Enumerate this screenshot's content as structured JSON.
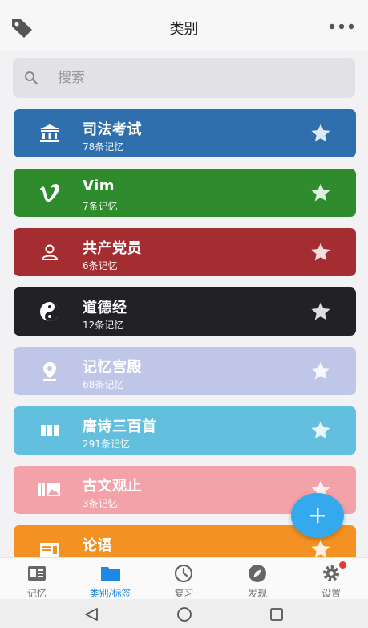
{
  "header": {
    "title": "类别",
    "left_icon": "tag-icon",
    "right_icon": "more-icon"
  },
  "search": {
    "placeholder": "搜索",
    "icon": "search-icon"
  },
  "categories": [
    {
      "name": "司法考试",
      "count": "78条记忆",
      "color": "#2f6fae",
      "icon": "bank-icon",
      "starred": true
    },
    {
      "name": "Vim",
      "count": "7条记忆",
      "color": "#2e8c2c",
      "icon": "vimeo-icon",
      "starred": true
    },
    {
      "name": "共产党员",
      "count": "6条记忆",
      "color": "#a42d31",
      "icon": "person-icon",
      "starred": true
    },
    {
      "name": "道德经",
      "count": "12条记忆",
      "color": "#222226",
      "icon": "yin-yang-icon",
      "starred": true
    },
    {
      "name": "记忆宫殿",
      "count": "68条记忆",
      "color": "#bfc6e8",
      "icon": "map-pin-icon",
      "starred": true
    },
    {
      "name": "唐诗三百首",
      "count": "291条记忆",
      "color": "#62bfdd",
      "icon": "columns-icon",
      "starred": true
    },
    {
      "name": "古文观止",
      "count": "3条记忆",
      "color": "#f3a2a9",
      "icon": "gallery-icon",
      "starred": true
    },
    {
      "name": "论语",
      "count": "",
      "color": "#f39223",
      "icon": "book-icon",
      "starred": true
    }
  ],
  "fab": {
    "icon": "plus-icon",
    "color": "#35a9ee"
  },
  "tabs": [
    {
      "label": "记忆",
      "icon": "memory-card-icon",
      "active": false
    },
    {
      "label": "类别/标签",
      "icon": "folder-icon",
      "active": true
    },
    {
      "label": "复习",
      "icon": "clock-icon",
      "active": false
    },
    {
      "label": "发现",
      "icon": "compass-icon",
      "active": false
    },
    {
      "label": "设置",
      "icon": "gear-icon",
      "active": false,
      "badge": true
    }
  ],
  "navbar": {
    "back_icon": "back-triangle-icon",
    "home_icon": "home-circle-icon",
    "recents_icon": "recents-square-icon"
  }
}
